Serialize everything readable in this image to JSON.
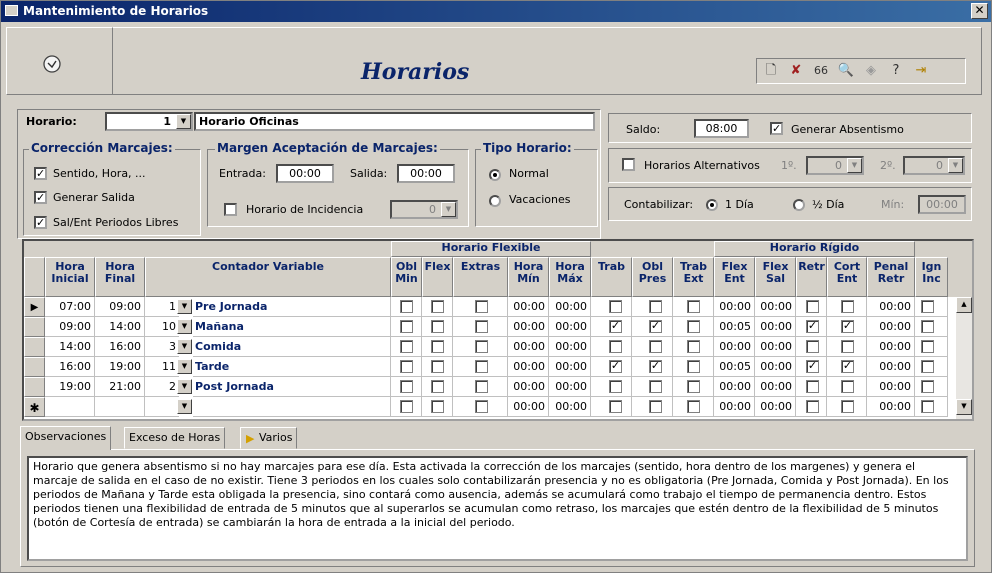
{
  "window": {
    "title": "Mantenimiento de Horarios",
    "close_label": "✕"
  },
  "header": {
    "title": "Horarios"
  },
  "toolbar": {
    "icons": [
      "new-record-icon",
      "delete-icon",
      "glasses-icon",
      "preview-icon",
      "erase-icon",
      "help-icon",
      "exit-icon"
    ]
  },
  "horario": {
    "label": "Horario:",
    "number": "1",
    "name": "Horario Oficinas"
  },
  "saldo": {
    "label": "Saldo:",
    "value": "08:00",
    "generar_label": "Generar Absentismo"
  },
  "correccion": {
    "title": "Corrección Marcajes:",
    "items": [
      "Sentido, Hora, ...",
      "Generar Salida",
      "Sal/Ent Periodos Libres"
    ]
  },
  "margen": {
    "title": "Margen Aceptación de Marcajes:",
    "entrada_label": "Entrada:",
    "entrada": "00:00",
    "salida_label": "Salida:",
    "salida": "00:00",
    "incidencia_label": "Horario de Incidencia",
    "incidencia_value": "0"
  },
  "tipo": {
    "title": "Tipo Horario:",
    "options": [
      "Normal",
      "Vacaciones"
    ]
  },
  "alternativos": {
    "label": "Horarios Alternativos",
    "first_label": "1º.",
    "first": "0",
    "second_label": "2º.",
    "second": "0"
  },
  "contabilizar": {
    "label": "Contabilizar:",
    "opt1": "1 Día",
    "opt2": "½ Día",
    "min_label": "Mín:",
    "min_value": "00:00"
  },
  "grid": {
    "flex_group": "Horario Flexible",
    "rigid_group": "Horario Rígido",
    "headers": {
      "hora_inicial": "Hora Inicial",
      "hora_final": "Hora Final",
      "contador": "Contador Variable",
      "obl_min": "Obl Min",
      "flex": "Flex",
      "extras": "Extras",
      "hora_min": "Hora Mín",
      "hora_max": "Hora Máx",
      "trab": "Trab",
      "obl_pres": "Obl Pres",
      "trab_ext": "Trab Ext",
      "flex_ent": "Flex Ent",
      "flex_sal": "Flex Sal",
      "retr": "Retr",
      "cort_ent": "Cort Ent",
      "penal_retr": "Penal Retr",
      "ign_inc": "Ign Inc"
    },
    "rows": [
      {
        "ini": "07:00",
        "fin": "09:00",
        "num": "1",
        "name": "Pre Jornada",
        "hmin": "00:00",
        "hmax": "00:00",
        "trab": false,
        "obl": false,
        "fent": "00:00",
        "fsal": "00:00",
        "retr": false,
        "cort": false,
        "penal": "00:00"
      },
      {
        "ini": "09:00",
        "fin": "14:00",
        "num": "10",
        "name": "Mañana",
        "hmin": "00:00",
        "hmax": "00:00",
        "trab": true,
        "obl": true,
        "fent": "00:05",
        "fsal": "00:00",
        "retr": true,
        "cort": true,
        "penal": "00:00"
      },
      {
        "ini": "14:00",
        "fin": "16:00",
        "num": "3",
        "name": "Comida",
        "hmin": "00:00",
        "hmax": "00:00",
        "trab": false,
        "obl": false,
        "fent": "00:00",
        "fsal": "00:00",
        "retr": false,
        "cort": false,
        "penal": "00:00"
      },
      {
        "ini": "16:00",
        "fin": "19:00",
        "num": "11",
        "name": "Tarde",
        "hmin": "00:00",
        "hmax": "00:00",
        "trab": true,
        "obl": true,
        "fent": "00:05",
        "fsal": "00:00",
        "retr": true,
        "cort": true,
        "penal": "00:00"
      },
      {
        "ini": "19:00",
        "fin": "21:00",
        "num": "2",
        "name": "Post Jornada",
        "hmin": "00:00",
        "hmax": "00:00",
        "trab": false,
        "obl": false,
        "fent": "00:00",
        "fsal": "00:00",
        "retr": false,
        "cort": false,
        "penal": "00:00"
      }
    ],
    "new_row": {
      "hmin": "00:00",
      "hmax": "00:00",
      "fent": "00:00",
      "fsal": "00:00",
      "penal": "00:00"
    }
  },
  "tabs": [
    "Observaciones",
    "Exceso de Horas",
    "Varios"
  ],
  "observaciones": "Horario que genera absentismo si no hay marcajes para ese día. Esta activada la corrección de los marcajes (sentido, hora dentro de los margenes) y genera el marcaje de salida en el caso de no existir. Tiene 3 periodos en los cuales solo contabilizarán presencia y no es obligatoria (Pre Jornada, Comida y Post Jornada). En los periodos de Mañana y Tarde esta obligada la presencia, sino contará como ausencia, además se acumulará como trabajo el tiempo de permanencia dentro. Estos periodos tienen una flexibilidad de entrada de 5 minutos que al superarlos se acumulan como retraso, los marcajes que estén dentro de la flexibilidad de 5 minutos (botón de Cortesía de entrada) se cambiarán la hora de entrada a la inicial del periodo."
}
